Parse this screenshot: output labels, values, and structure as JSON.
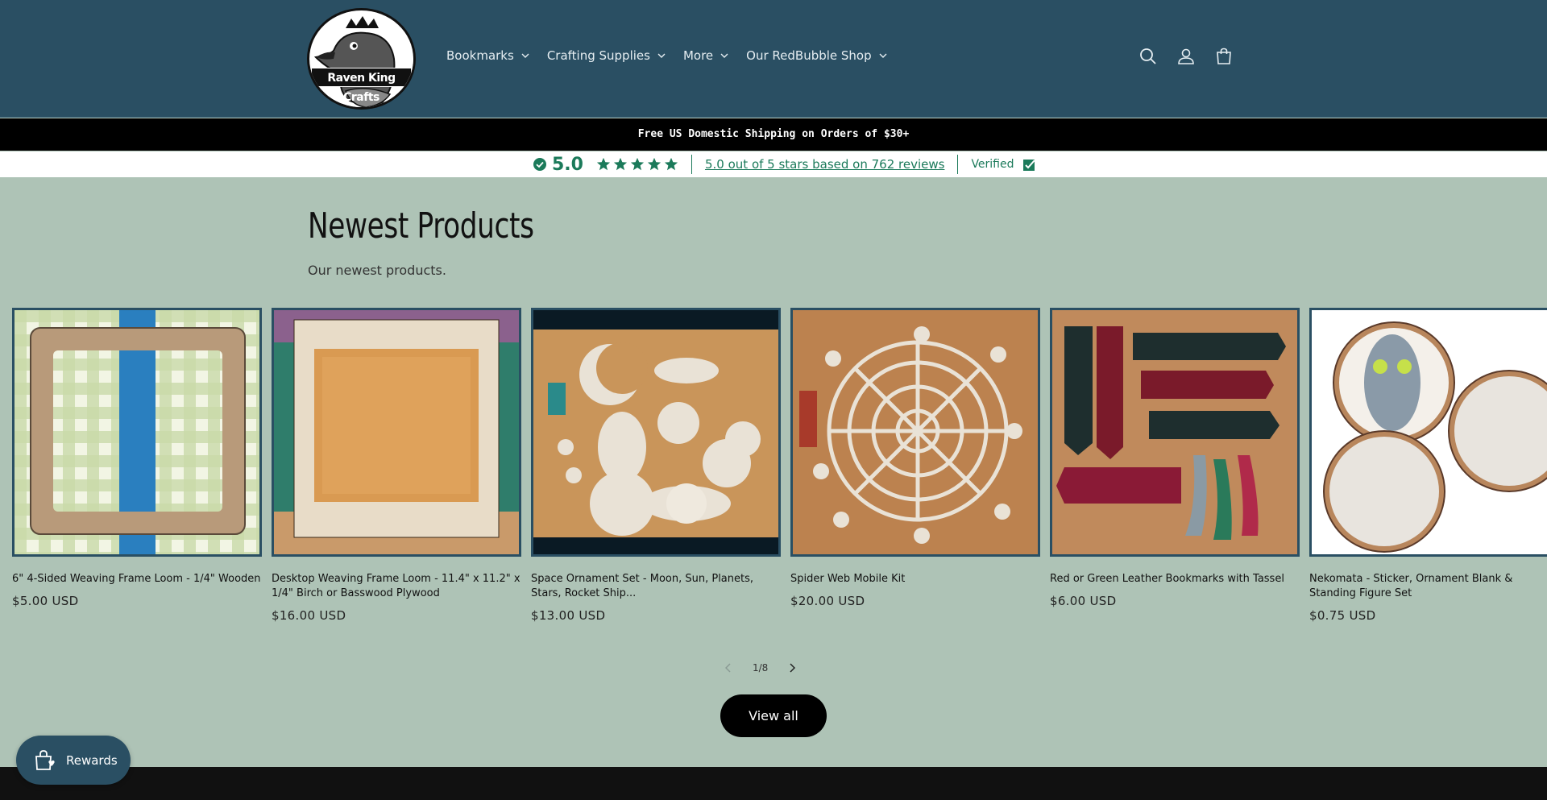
{
  "brand": {
    "name": "Raven King Crafts"
  },
  "nav": {
    "items": [
      {
        "label": "Bookmarks"
      },
      {
        "label": "Crafting Supplies"
      },
      {
        "label": "More"
      },
      {
        "label": "Our RedBubble Shop"
      }
    ]
  },
  "header_icons": [
    "search-icon",
    "account-icon",
    "cart-icon"
  ],
  "announcement": {
    "text": "Free US Domestic Shipping on Orders of $30+"
  },
  "reviews": {
    "score": "5.0",
    "stars": 5,
    "link_text": "5.0 out of 5 stars based on 762 reviews",
    "verified_label": "Verified"
  },
  "section": {
    "title": "Newest Products",
    "subtitle": "Our newest products."
  },
  "products": [
    {
      "title": "6\" 4-Sided Weaving Frame Loom - 1/4\" Wooden",
      "price": "$5.00 USD"
    },
    {
      "title": "Desktop Weaving Frame Loom - 11.4\" x 11.2\" x 1/4\" Birch or Basswood Plywood",
      "price": "$16.00 USD"
    },
    {
      "title": "Space Ornament Set - Moon, Sun, Planets, Stars, Rocket Ship...",
      "price": "$13.00 USD"
    },
    {
      "title": "Spider Web Mobile Kit",
      "price": "$20.00 USD"
    },
    {
      "title": "Red or Green Leather Bookmarks with Tassel",
      "price": "$6.00 USD"
    },
    {
      "title": "Nekomata - Sticker, Ornament Blank & Standing Figure Set",
      "price": "$0.75 USD"
    }
  ],
  "pagination": {
    "current": "1/8"
  },
  "view_all": {
    "label": "View all"
  },
  "rewards": {
    "label": "Rewards"
  },
  "colors": {
    "header": "#2a4f63",
    "section_bg": "#aec3b6",
    "accent_green": "#1b7a5a"
  }
}
